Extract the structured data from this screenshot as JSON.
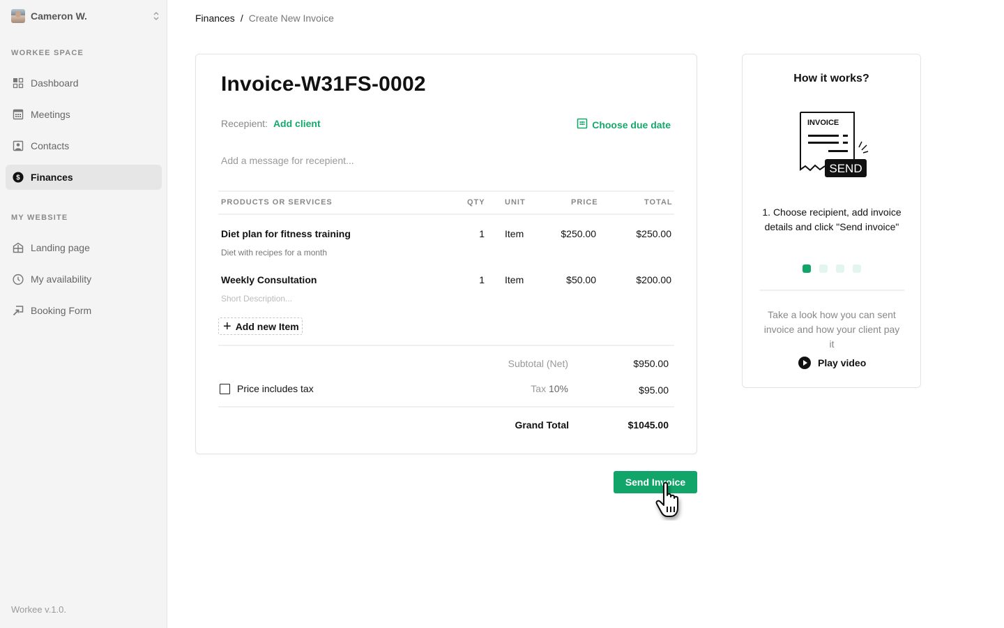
{
  "user": {
    "name": "Cameron W.",
    "avatar_icon": "user-photo",
    "switch_icon": "chevron-up-down-icon"
  },
  "sidebar": {
    "section1": "WORKEE SPACE",
    "items1": [
      {
        "label": "Dashboard",
        "icon": "dashboard-grid-icon"
      },
      {
        "label": "Meetings",
        "icon": "calendar-icon"
      },
      {
        "label": "Contacts",
        "icon": "contact-card-icon"
      },
      {
        "label": "Finances",
        "icon": "dollar-circle-icon",
        "active": true
      }
    ],
    "section2": "MY WEBSITE",
    "items2": [
      {
        "label": "Landing page",
        "icon": "landing-page-icon"
      },
      {
        "label": "My availability",
        "icon": "clock-icon"
      },
      {
        "label": "Booking Form",
        "icon": "booking-form-icon"
      }
    ],
    "version": "Workee v.1.0."
  },
  "breadcrumb": {
    "root": "Finances",
    "separator": "/",
    "current": "Create New Invoice"
  },
  "invoice": {
    "title": "Invoice-W31FS-0002",
    "recipient_label": "Recepient:",
    "add_client": "Add client",
    "due_date": "Choose due date",
    "message_placeholder": "Add a message for recepient...",
    "columns": {
      "product": "PRODUCTS OR SERVICES",
      "qty": "QTY",
      "unit": "UNIT",
      "price": "PRICE",
      "total": "TOTAL"
    },
    "items": [
      {
        "name": "Diet plan for fitness training",
        "description": "Diet with recipes for a month",
        "qty": "1",
        "unit": "Item",
        "price": "$250.00",
        "total": "$250.00"
      },
      {
        "name": "Weekly Consultation",
        "description": "Short Description...",
        "qty": "1",
        "unit": "Item",
        "price": "$50.00",
        "total": "$200.00"
      }
    ],
    "add_item": "Add new Item",
    "subtotal_label": "Subtotal (Net)",
    "subtotal": "$950.00",
    "tax_label": "Tax",
    "tax_rate": "10%",
    "tax": "$95.00",
    "price_includes_tax": "Price includes tax",
    "price_includes_tax_checked": false,
    "grand_total_label": "Grand Total",
    "grand_total": "$1045.00",
    "send_button": "Send Invoice"
  },
  "help": {
    "title": "How it works?",
    "illustration": {
      "doc_label": "INVOICE",
      "badge_label": "SEND"
    },
    "step_text": "1. Choose recipient, add invoice details and click \"Send invoice\"",
    "steps_total": 4,
    "step_active": 1,
    "video_text": "Take a look how you can sent invoice and how your client pay it",
    "play_label": "Play video"
  },
  "colors": {
    "accent": "#12a56a",
    "sidebar_bg": "#f4f4f4",
    "active_item_bg": "#e6e6e6"
  }
}
